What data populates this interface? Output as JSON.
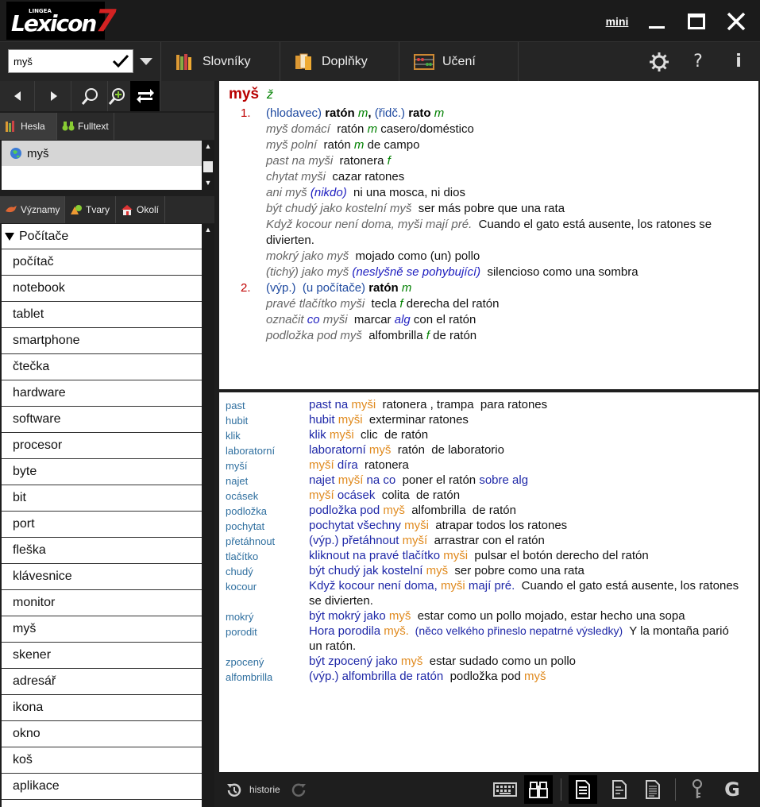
{
  "app": {
    "logo_brand": "LINGEA",
    "logo_text": "Lexicon",
    "logo_seven": "7",
    "window_mini": "mini"
  },
  "toolbar": {
    "search_value": "myš",
    "tabs": [
      {
        "label": "Slovníky",
        "icon": "books-icon"
      },
      {
        "label": "Doplňky",
        "icon": "documents-icon"
      },
      {
        "label": "Učení",
        "icon": "abacus-icon"
      }
    ]
  },
  "left": {
    "tabs": {
      "hesla": "Hesla",
      "fulltext": "Fulltext"
    },
    "headword": "myš",
    "meaning_tabs": {
      "vyznamy": "Významy",
      "tvary": "Tvary",
      "okoli": "Okolí"
    },
    "tree_head": "Počítače",
    "tree_items": [
      "počítač",
      "notebook",
      "tablet",
      "smartphone",
      "čtečka",
      "hardware",
      "software",
      "procesor",
      "byte",
      "bit",
      "port",
      "fleška",
      "klávesnice",
      "monitor",
      "myš",
      "skener",
      "adresář",
      "ikona",
      "okno",
      "koš",
      "aplikace"
    ]
  },
  "entry": {
    "headword": "myš",
    "gender": "ž",
    "senses": [
      {
        "num": "1.",
        "parts": [
          {
            "t": "(hlodavec) ",
            "c": "b"
          },
          {
            "t": "ratón",
            "c": "bold"
          },
          {
            "t": " m",
            "c": "g2"
          },
          {
            "t": ", ",
            "c": "bold"
          },
          {
            "t": "(řidč.) ",
            "c": "b"
          },
          {
            "t": "rato",
            "c": "bold"
          },
          {
            "t": " m",
            "c": "g2"
          }
        ]
      },
      {
        "num": "",
        "parts": [
          {
            "t": "myš domácí",
            "c": "it"
          },
          {
            "t": "  ratón ",
            "c": ""
          },
          {
            "t": "m",
            "c": "g2"
          },
          {
            "t": " casero/doméstico",
            "c": ""
          }
        ]
      },
      {
        "num": "",
        "parts": [
          {
            "t": "myš polní",
            "c": "it"
          },
          {
            "t": "  ratón ",
            "c": ""
          },
          {
            "t": "m",
            "c": "g2"
          },
          {
            "t": " de campo",
            "c": ""
          }
        ]
      },
      {
        "num": "",
        "parts": [
          {
            "t": "past na myši",
            "c": "it"
          },
          {
            "t": "  ratonera ",
            "c": ""
          },
          {
            "t": "f",
            "c": "g2"
          }
        ]
      },
      {
        "num": "",
        "parts": [
          {
            "t": "chytat myši",
            "c": "it"
          },
          {
            "t": "  cazar ratones",
            "c": ""
          }
        ]
      },
      {
        "num": "",
        "parts": [
          {
            "t": "ani myš ",
            "c": "it"
          },
          {
            "t": "(nikdo)",
            "c": "bl"
          },
          {
            "t": "  ni una mosca, ni dios",
            "c": ""
          }
        ]
      },
      {
        "num": "",
        "parts": [
          {
            "t": "být chudý jako kostelní myš",
            "c": "it"
          },
          {
            "t": "  ser más pobre que una rata",
            "c": ""
          }
        ]
      },
      {
        "num": "",
        "parts": [
          {
            "t": "Když kocour není doma, myši mají pré.",
            "c": "it"
          },
          {
            "t": "  Cuando el gato está ausente, los ratones se divierten.",
            "c": ""
          }
        ]
      },
      {
        "num": "",
        "parts": [
          {
            "t": "mokrý jako myš",
            "c": "it"
          },
          {
            "t": "  mojado como (un) pollo",
            "c": ""
          }
        ]
      },
      {
        "num": "",
        "parts": [
          {
            "t": "(tichý) jako myš ",
            "c": "it"
          },
          {
            "t": "(neslyšně se pohybující)",
            "c": "bl"
          },
          {
            "t": "  silencioso como una sombra",
            "c": ""
          }
        ]
      },
      {
        "num": "2.",
        "parts": [
          {
            "t": "(výp.)  (u počítače) ",
            "c": "b"
          },
          {
            "t": "ratón",
            "c": "bold"
          },
          {
            "t": " m",
            "c": "g2"
          }
        ]
      },
      {
        "num": "",
        "parts": [
          {
            "t": "pravé tlačítko myši",
            "c": "it"
          },
          {
            "t": "  tecla ",
            "c": ""
          },
          {
            "t": "f",
            "c": "g2"
          },
          {
            "t": " derecha del ratón",
            "c": ""
          }
        ]
      },
      {
        "num": "",
        "parts": [
          {
            "t": "označit ",
            "c": "it"
          },
          {
            "t": "co",
            "c": "bl"
          },
          {
            "t": " myši",
            "c": "it"
          },
          {
            "t": "  marcar ",
            "c": ""
          },
          {
            "t": "alg",
            "c": "bl"
          },
          {
            "t": " con el ratón",
            "c": ""
          }
        ]
      },
      {
        "num": "",
        "parts": [
          {
            "t": "podložka pod myš",
            "c": "it"
          },
          {
            "t": "  alfombrilla ",
            "c": ""
          },
          {
            "t": "f",
            "c": "g2"
          },
          {
            "t": " de ratón",
            "c": ""
          }
        ]
      }
    ]
  },
  "fulltext": [
    {
      "key": "past",
      "parts": [
        {
          "t": "past na ",
          "c": "c"
        },
        {
          "t": "myši",
          "c": "o"
        },
        {
          "t": "  ratonera , trampa  para ratones",
          "c": "n"
        }
      ]
    },
    {
      "key": "hubit",
      "parts": [
        {
          "t": "hubit ",
          "c": "c"
        },
        {
          "t": "myši",
          "c": "o"
        },
        {
          "t": "  exterminar ratones",
          "c": "n"
        }
      ]
    },
    {
      "key": "klik",
      "parts": [
        {
          "t": "klik ",
          "c": "c"
        },
        {
          "t": "myši",
          "c": "o"
        },
        {
          "t": "  clic  de ratón",
          "c": "n"
        }
      ]
    },
    {
      "key": "laboratorní",
      "parts": [
        {
          "t": "laboratorní ",
          "c": "c"
        },
        {
          "t": "myš",
          "c": "o"
        },
        {
          "t": "  ratón  de laboratorio",
          "c": "n"
        }
      ]
    },
    {
      "key": "myší",
      "parts": [
        {
          "t": "myší",
          "c": "o"
        },
        {
          "t": " díra",
          "c": "c"
        },
        {
          "t": "  ratonera",
          "c": "n"
        }
      ]
    },
    {
      "key": "najet",
      "parts": [
        {
          "t": "najet ",
          "c": "c"
        },
        {
          "t": "myší",
          "c": "o"
        },
        {
          "t": " na co",
          "c": "c"
        },
        {
          "t": "  poner el ratón ",
          "c": "n"
        },
        {
          "t": "sobre alg",
          "c": "c"
        }
      ]
    },
    {
      "key": "ocásek",
      "parts": [
        {
          "t": "myší",
          "c": "o"
        },
        {
          "t": " ocásek",
          "c": "c"
        },
        {
          "t": "  colita  de ratón",
          "c": "n"
        }
      ]
    },
    {
      "key": "podložka",
      "parts": [
        {
          "t": "podložka pod ",
          "c": "c"
        },
        {
          "t": "myš",
          "c": "o"
        },
        {
          "t": "  alfombrilla  de ratón",
          "c": "n"
        }
      ]
    },
    {
      "key": "pochytat",
      "parts": [
        {
          "t": "pochytat všechny ",
          "c": "c"
        },
        {
          "t": "myši",
          "c": "o"
        },
        {
          "t": "  atrapar todos los ratones",
          "c": "n"
        }
      ]
    },
    {
      "key": "přetáhnout",
      "parts": [
        {
          "t": "(výp.) přetáhnout ",
          "c": "c"
        },
        {
          "t": "myší",
          "c": "o"
        },
        {
          "t": "  arrastrar con el ratón",
          "c": "n"
        }
      ]
    },
    {
      "key": "tlačítko",
      "parts": [
        {
          "t": "kliknout na pravé tlačítko ",
          "c": "c"
        },
        {
          "t": "myši",
          "c": "o"
        },
        {
          "t": "  pulsar el botón derecho del ratón",
          "c": "n"
        }
      ]
    },
    {
      "key": "chudý",
      "parts": [
        {
          "t": "být chudý jak kostelní ",
          "c": "c"
        },
        {
          "t": "myš",
          "c": "o"
        },
        {
          "t": "  ser pobre como una rata",
          "c": "n"
        }
      ]
    },
    {
      "key": "kocour",
      "parts": [
        {
          "t": "Když kocour není doma, ",
          "c": "c"
        },
        {
          "t": "myši",
          "c": "o"
        },
        {
          "t": " mají pré.",
          "c": "c"
        },
        {
          "t": "  Cuando el gato está ausente, los ratones se divierten.",
          "c": "n"
        }
      ]
    },
    {
      "key": "mokrý",
      "parts": [
        {
          "t": "být mokrý jako ",
          "c": "c"
        },
        {
          "t": "myš",
          "c": "o"
        },
        {
          "t": "  estar como un pollo mojado, estar hecho una sopa",
          "c": "n"
        }
      ]
    },
    {
      "key": "porodit",
      "parts": [
        {
          "t": "Hora porodila ",
          "c": "c"
        },
        {
          "t": "myš.",
          "c": "o"
        },
        {
          "t": "  (něco velkého přineslo nepatrné výsledky)",
          "c": "p"
        },
        {
          "t": "  Y la montaña parió un ratón.",
          "c": "n"
        }
      ]
    },
    {
      "key": "zpocený",
      "parts": [
        {
          "t": "být zpocený jako ",
          "c": "c"
        },
        {
          "t": "myš",
          "c": "o"
        },
        {
          "t": "  estar sudado como un pollo",
          "c": "n"
        }
      ]
    },
    {
      "key": "alfombrilla",
      "parts": [
        {
          "t": "(výp.) alfombrilla de ratón",
          "c": "c"
        },
        {
          "t": "  podložka pod ",
          "c": "n"
        },
        {
          "t": "myš",
          "c": "o"
        }
      ]
    }
  ],
  "bottom": {
    "history_label": "historie"
  }
}
